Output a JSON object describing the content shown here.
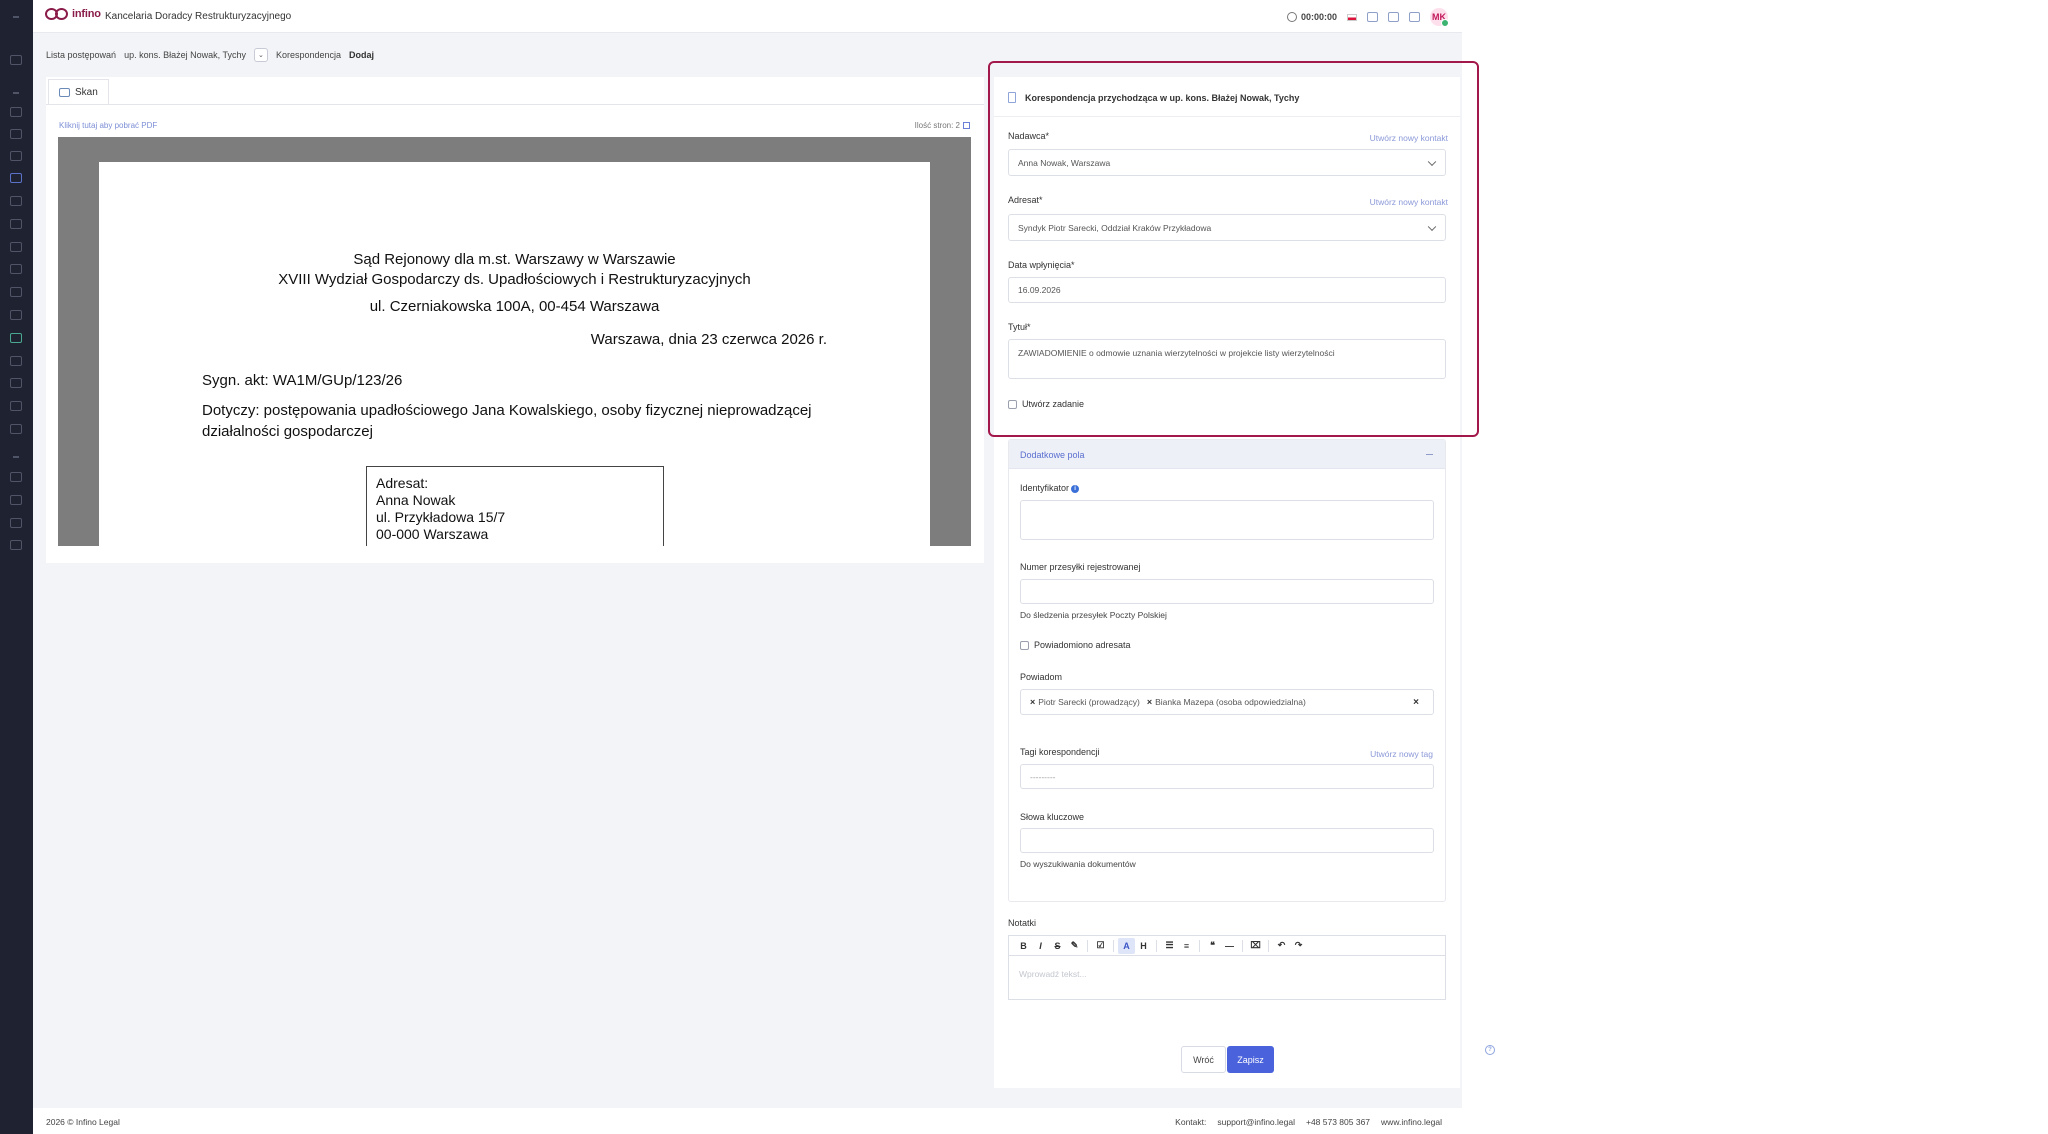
{
  "app": {
    "logo_text": "infino",
    "title": "Kancelaria Doradcy Restrukturyzacyjnego",
    "timer": "00:00:00",
    "avatar": "MK",
    "brand_color": "#8a1c4a",
    "accent_color": "#4a63dc",
    "highlight_color": "#a3184a"
  },
  "breadcrumb": {
    "items": [
      "Lista postępowań",
      "up. kons. Błażej Nowak, Tychy",
      "Korespondencja",
      "Dodaj"
    ]
  },
  "scan": {
    "tab_label": "Skan",
    "pdf_link": "Kliknij tutaj aby pobrać PDF",
    "page_count": "Ilość stron: 2",
    "document": {
      "court_line1": "Sąd Rejonowy dla m.st. Warszawy w Warszawie",
      "court_line2": "XVIII Wydział Gospodarczy ds. Upadłościowych i Restrukturyzacyjnych",
      "court_address": "ul. Czerniakowska 100A, 00-454 Warszawa",
      "date": "Warszawa, dnia 23 czerwca 2026 r.",
      "signature": "Sygn. akt: WA1M/GUp/123/26",
      "regarding_line1": "Dotyczy: postępowania upadłościowego Jana Kowalskiego, osoby fizycznej nieprowadzącej",
      "regarding_line2": "działalności gospodarczej",
      "addressee_label": "Adresat:",
      "addressee_name": "Anna Nowak",
      "addressee_street": "ul. Przykładowa 15/7",
      "addressee_city": "00-000 Warszawa"
    }
  },
  "form": {
    "header": "Korespondencja przychodząca w up. kons. Błażej Nowak, Tychy",
    "sender": {
      "label": "Nadawca*",
      "link": "Utwórz nowy kontakt",
      "value": "Anna Nowak, Warszawa"
    },
    "recipient": {
      "label": "Adresat*",
      "link": "Utwórz nowy kontakt",
      "value": "Syndyk Piotr Sarecki, Oddział Kraków Przykładowa"
    },
    "received_date": {
      "label": "Data wpłynięcia*",
      "value": "16.09.2026"
    },
    "doc_title": {
      "label": "Tytuł*",
      "value": "ZAWIADOMIENIE o odmowie uznania wierzytelności w projekcie listy wierzytelności"
    },
    "create_task": "Utwórz zadanie",
    "extra": {
      "title": "Dodatkowe pola",
      "identifier_label": "Identyfikator",
      "tracking_label": "Numer przesyłki rejestrowanej",
      "tracking_hint": "Do śledzenia przesyłek Poczty Polskiej",
      "notified_label": "Powiadomiono adresata",
      "notify_label": "Powiadom",
      "notify_tags": [
        "Piotr Sarecki (prowadzący)",
        "Bianka Mazepa (osoba odpowiedzialna)"
      ],
      "tags_label": "Tagi korespondencji",
      "tags_link": "Utwórz nowy tag",
      "tags_placeholder": "---------",
      "keywords_label": "Słowa kluczowe",
      "keywords_hint": "Do wyszukiwania dokumentów"
    },
    "notes": {
      "label": "Notatki",
      "placeholder": "Wprowadź tekst..."
    },
    "buttons": {
      "back": "Wróć",
      "save": "Zapisz"
    }
  },
  "footer": {
    "copyright": "2026 © Infino Legal",
    "contact_label": "Kontakt:",
    "email": "support@infino.legal",
    "phone": "+48 573 805 367",
    "website": "www.infino.legal"
  }
}
